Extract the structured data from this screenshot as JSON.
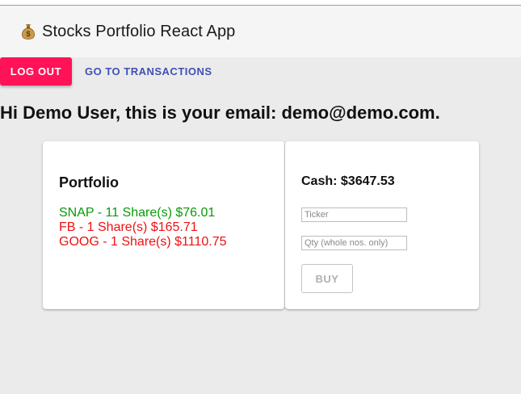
{
  "app": {
    "title": "Stocks Portfolio React App",
    "logo_icon": "money-bag-icon"
  },
  "nav": {
    "logout_label": "LOG OUT",
    "transactions_label": "GO TO TRANSACTIONS"
  },
  "greeting": "Hi Demo User, this is your email: demo@demo.com.",
  "portfolio": {
    "title": "Portfolio",
    "holdings": [
      {
        "text": "SNAP - 11 Share(s) $76.01",
        "color": "#0a9a0a"
      },
      {
        "text": "FB - 1 Share(s) $165.71",
        "color": "#f01010"
      },
      {
        "text": "GOOG - 1 Share(s) $1110.75",
        "color": "#f01010"
      }
    ]
  },
  "trade": {
    "cash_label": "Cash: $3647.53",
    "ticker_placeholder": "Ticker",
    "qty_placeholder": "Qty (whole nos. only)",
    "buy_label": "BUY"
  },
  "colors": {
    "logout_button": "#ff1257",
    "link": "#3f51b5",
    "gain": "#0a9a0a",
    "loss": "#f01010"
  }
}
